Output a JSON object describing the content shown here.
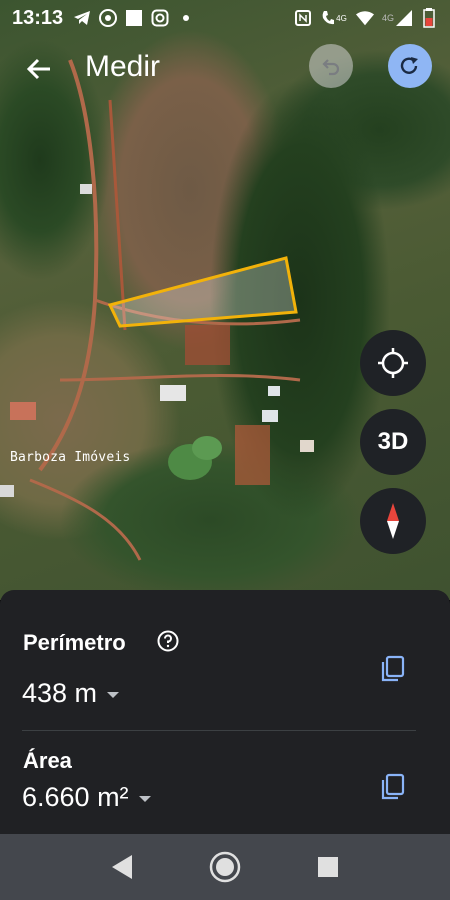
{
  "status_bar": {
    "time": "13:13",
    "network_label": "4G",
    "icons_left": [
      "telegram-icon",
      "chrome-icon",
      "square-icon",
      "instagram-icon",
      "dot-icon"
    ],
    "icons_right": [
      "nfc-icon",
      "call-4g-icon",
      "wifi-icon",
      "signal-icon",
      "battery-icon"
    ]
  },
  "appbar": {
    "title": "Medir",
    "back_icon": "arrow-left-icon",
    "undo_icon": "undo-icon",
    "redo_icon": "redo-icon"
  },
  "map": {
    "watermark": "Barboza Imóveis",
    "controls": {
      "locate_icon": "crosshair-icon",
      "view_3d_label": "3D",
      "compass_icon": "compass-icon"
    },
    "polygon_color": "#f2b20a"
  },
  "measurements": {
    "perimeter_label": "Perímetro",
    "perimeter_value": "438 m",
    "area_label": "Área",
    "area_value": "6.660 m²"
  },
  "colors": {
    "accent": "#8fb6f4",
    "sheet_bg": "#202124",
    "navbar_bg": "#44474d"
  }
}
